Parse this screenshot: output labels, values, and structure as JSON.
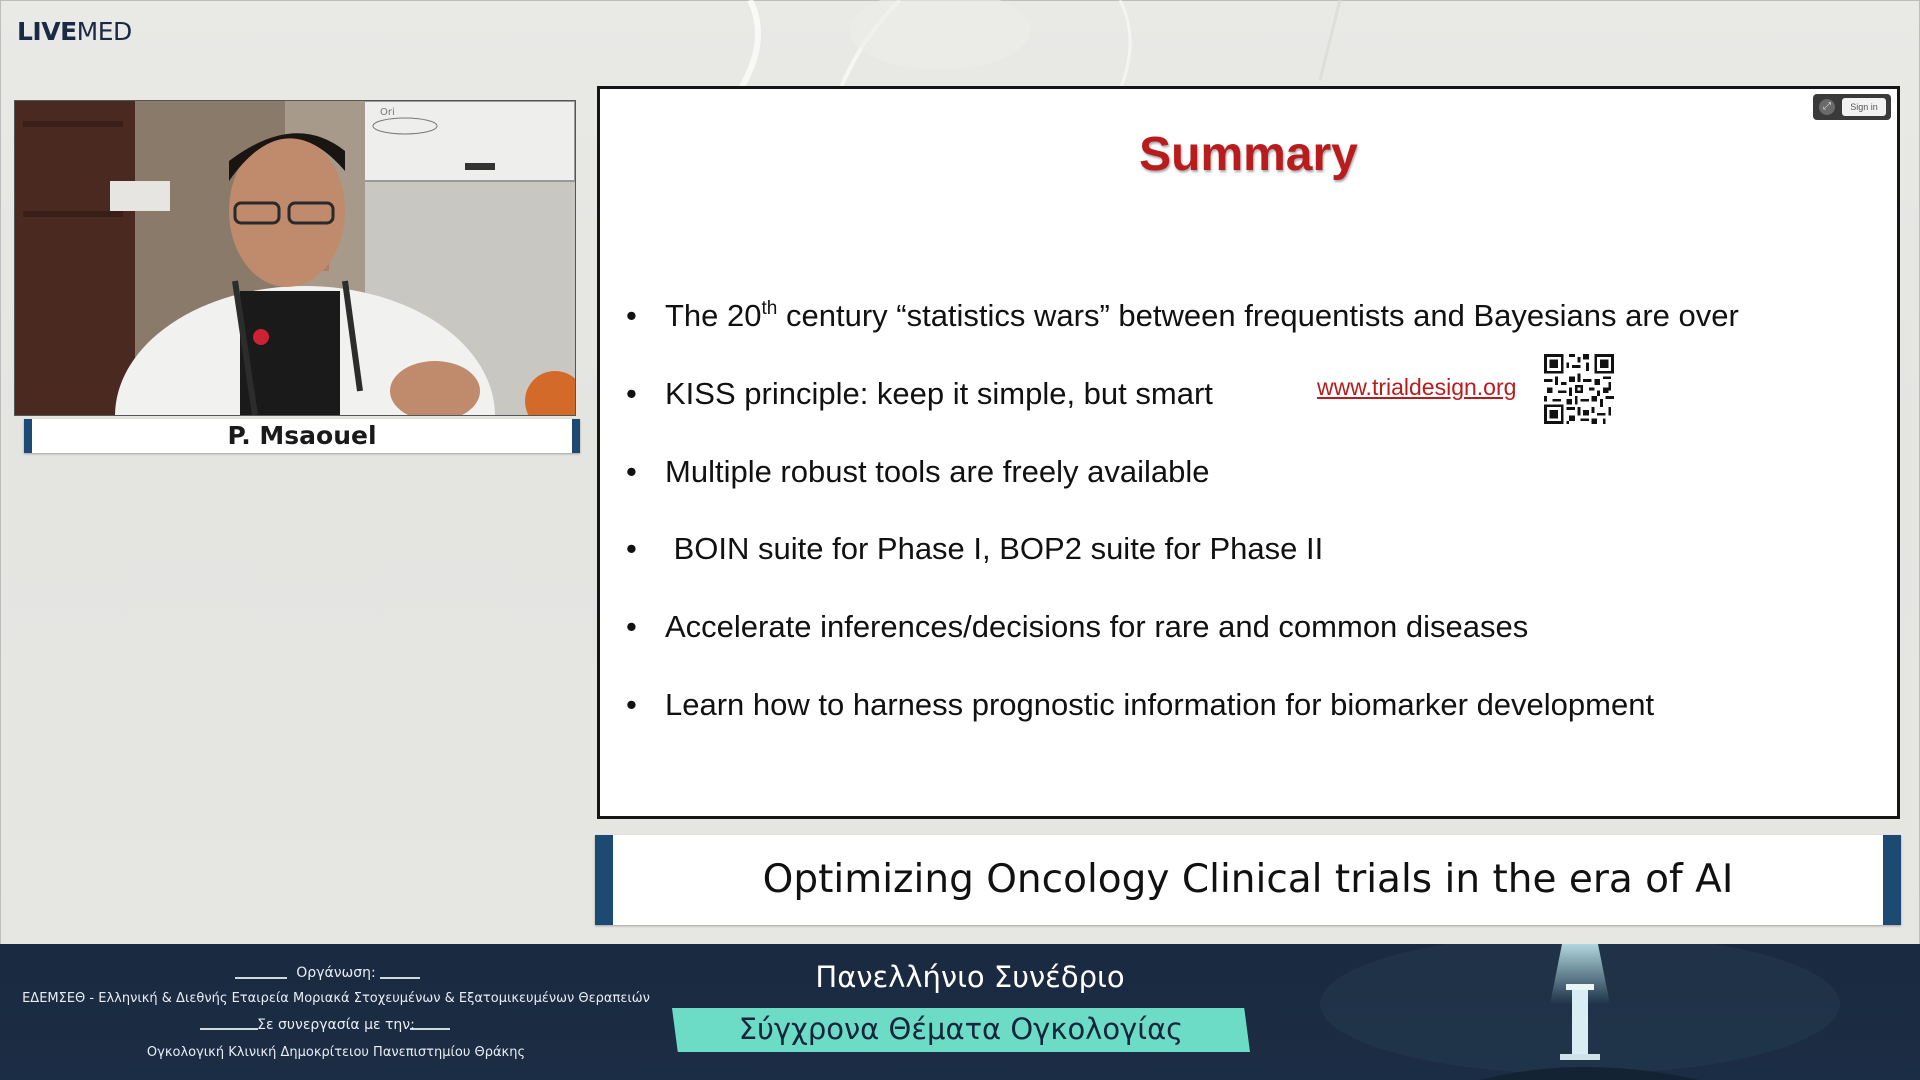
{
  "brand": {
    "logo_bold": "LIVE",
    "logo_light": "MED"
  },
  "speaker": {
    "name": "P. Msaouel"
  },
  "slide": {
    "title": "Summary",
    "bullet_symbol": "•",
    "bullets": [
      {
        "pre": "The 20",
        "sup": "th",
        "post": " century “statistics wars” between frequentists and Bayesians are over"
      },
      {
        "text": "KISS principle: keep it simple, but smart"
      },
      {
        "text": "Multiple robust tools are freely available"
      },
      {
        "text": " BOIN suite for Phase I, BOP2 suite for Phase II"
      },
      {
        "text": "Accelerate inferences/decisions for rare and common diseases"
      },
      {
        "text": "Learn how to harness prognostic information for biomarker development"
      }
    ],
    "link": "www.trialdesign.org",
    "controls": {
      "sign_in_label": "Sign in",
      "icon": "expand-icon"
    }
  },
  "talk_title": "Optimizing Oncology Clinical trials in the era of AI",
  "footer": {
    "organizer_label": "Οργάνωση:",
    "organizer": "ΕΔΕΜΣΕΘ - Ελληνική & Διεθνής Εταιρεία Μοριακά Στοχευμένων & Εξατομικευμένων Θεραπειών",
    "collab_label": "Σε συνεργασία με την:",
    "collaborator": "Ογκολογική Κλινική Δημοκρίτειου Πανεπιστημίου Θράκης",
    "conference_line1": "Πανελλήνιο Συνέδριο",
    "conference_line2": "Σύγχρονα Θέματα Ογκολογίας",
    "accent_color": "#6ddcc6",
    "background_color": "#1b2d44"
  },
  "colors": {
    "slide_title": "#b91c1c",
    "nameplate_bars": "#1d4a72"
  }
}
